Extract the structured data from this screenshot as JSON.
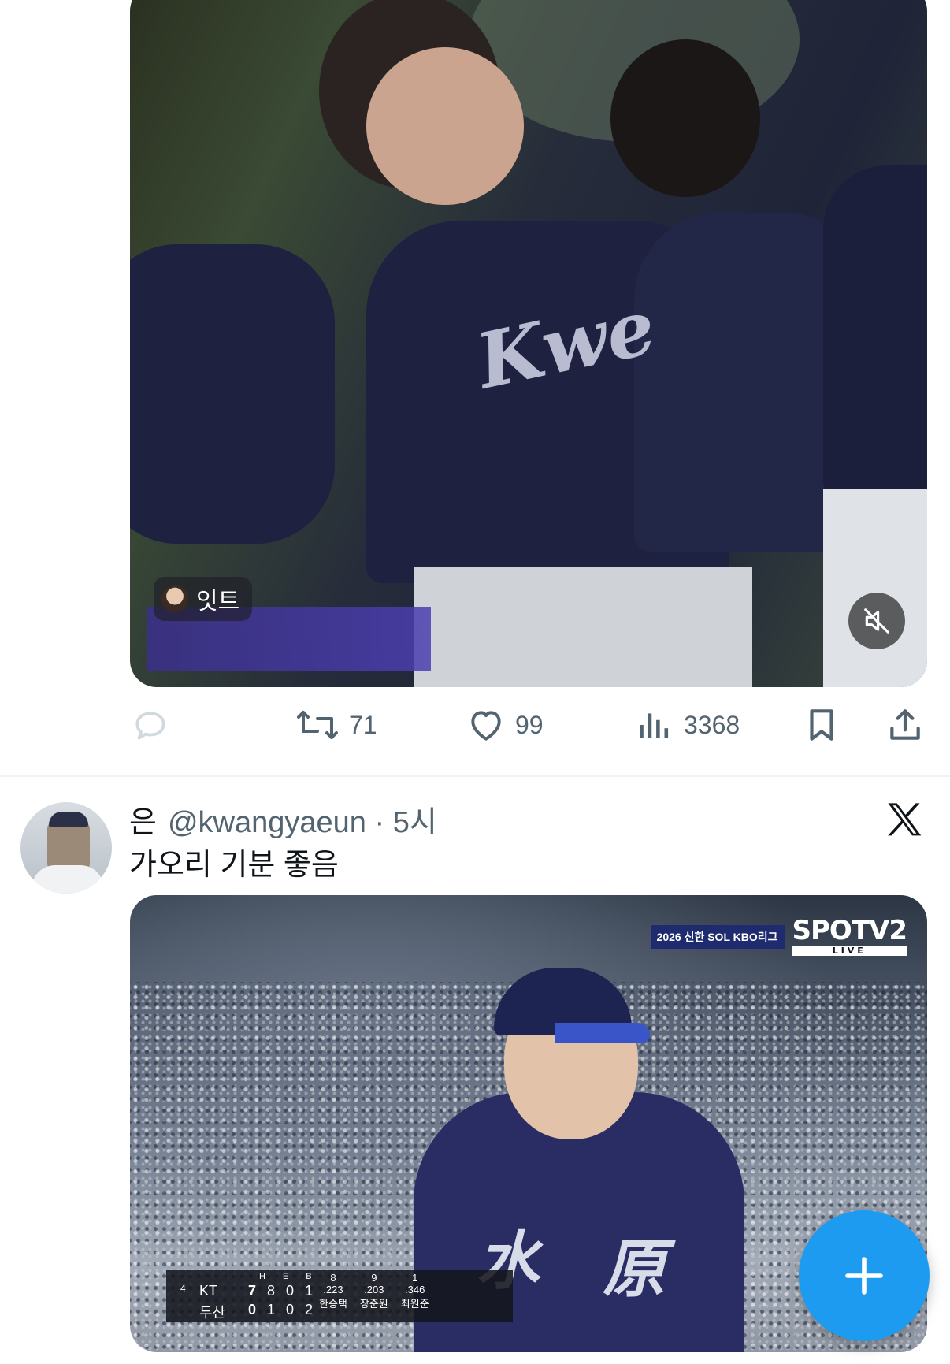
{
  "tweet1": {
    "video_badge_name": "잇트",
    "actions": {
      "reply_count": "",
      "retweet_count": "71",
      "like_count": "99",
      "view_count": "3368"
    }
  },
  "tweet2": {
    "display_name": "은",
    "handle_time": "@kwangyaeun · 5시",
    "text": "가오리 기분 좋음",
    "video": {
      "broadcast_tag": "2026 신한 SOL KBO리그",
      "channel": "SPOTV2",
      "channel_live": "LIVE",
      "scoreboard": {
        "headers": [
          "H",
          "E",
          "B"
        ],
        "rows": [
          {
            "team": "KT",
            "runs": "7",
            "h": "8",
            "e": "0",
            "b": "1"
          },
          {
            "team": "두산",
            "runs": "0",
            "h": "1",
            "e": "0",
            "b": "2"
          }
        ],
        "inning": "4"
      },
      "lineup": [
        {
          "order": "8",
          "avg": ".223",
          "name": "한승택"
        },
        {
          "order": "9",
          "avg": ".203",
          "name": "장준원"
        },
        {
          "order": "1",
          "avg": ".346",
          "name": "최원준"
        }
      ]
    }
  },
  "icons": {
    "reply": "reply-icon",
    "retweet": "retweet-icon",
    "like": "heart-icon",
    "views": "views-icon",
    "bookmark": "bookmark-icon",
    "share": "share-icon",
    "mute": "mute-icon",
    "x_logo": "x-logo-icon",
    "compose": "plus-icon"
  },
  "colors": {
    "accent": "#1d9bf0",
    "secondary_text": "#536471",
    "divider": "#eff3f4"
  }
}
